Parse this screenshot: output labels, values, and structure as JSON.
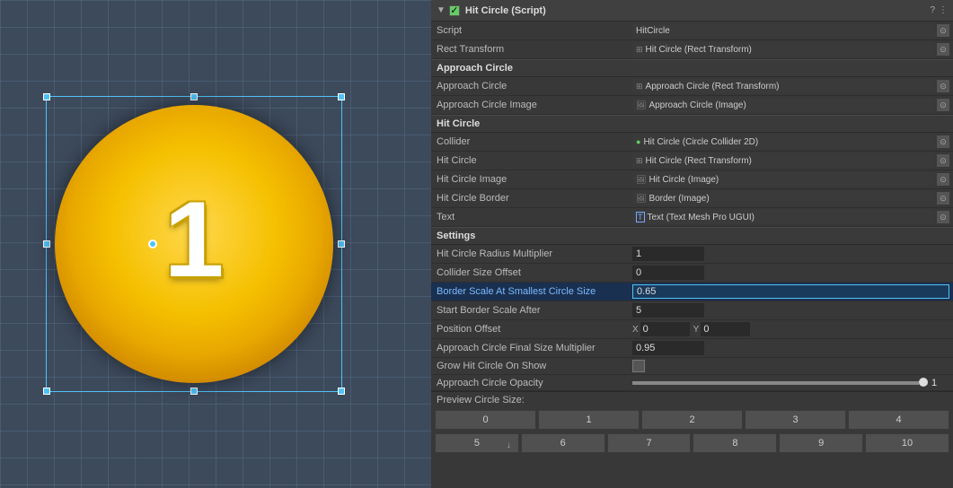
{
  "scene": {
    "circle_number": "1"
  },
  "inspector": {
    "title": "Hit Circle (Script)",
    "icons": [
      "?",
      "⋮"
    ],
    "rows": {
      "script_label": "Script",
      "script_value": "HitCircle",
      "rect_transform_label": "Rect Transform",
      "rect_transform_value": "Hit Circle (Rect Transform)",
      "approach_circle_section": "Approach Circle",
      "approach_circle_label": "Approach Circle",
      "approach_circle_value": "Approach Circle (Rect Transform)",
      "approach_circle_image_label": "Approach Circle Image",
      "approach_circle_image_value": "Approach Circle (Image)",
      "hit_circle_section": "Hit Circle",
      "collider_label": "Collider",
      "collider_value": "Hit Circle (Circle Collider 2D)",
      "hit_circle_label": "Hit Circle",
      "hit_circle_value": "Hit Circle (Rect Transform)",
      "hit_circle_image_label": "Hit Circle Image",
      "hit_circle_image_value": "Hit Circle (Image)",
      "hit_circle_border_label": "Hit Circle Border",
      "hit_circle_border_value": "Border (Image)",
      "text_label": "Text",
      "text_value": "Text (Text Mesh Pro UGUI)",
      "settings_section": "Settings",
      "hit_circle_radius_label": "Hit Circle Radius Multiplier",
      "hit_circle_radius_value": "1",
      "collider_size_label": "Collider Size Offset",
      "collider_size_value": "0",
      "border_scale_label": "Border Scale At Smallest Circle Size",
      "border_scale_value": "0.65",
      "start_border_label": "Start Border Scale After",
      "start_border_value": "5",
      "position_offset_label": "Position Offset",
      "position_x_label": "X",
      "position_x_value": "0",
      "position_y_label": "Y",
      "position_y_value": "0",
      "approach_final_label": "Approach Circle Final Size Multiplier",
      "approach_final_value": "0.95",
      "grow_hit_label": "Grow Hit Circle On Show",
      "approach_opacity_label": "Approach Circle Opacity",
      "approach_opacity_value": "1",
      "preview_size_label": "Preview Circle Size:"
    },
    "preview_buttons": [
      "0",
      "1",
      "2",
      "3",
      "4",
      "5",
      "6",
      "7",
      "8",
      "9",
      "10"
    ]
  }
}
